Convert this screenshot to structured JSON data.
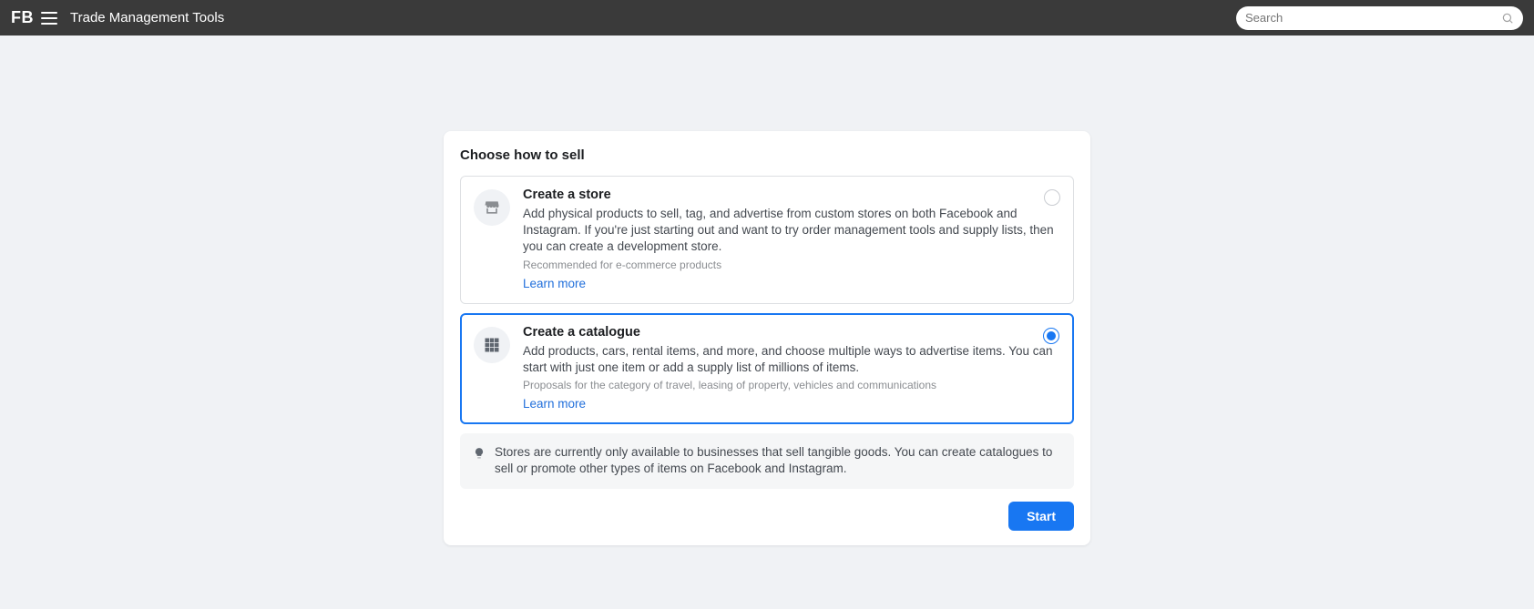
{
  "header": {
    "logo": "FB",
    "app_title": "Trade Management Tools",
    "search_placeholder": "Search"
  },
  "panel": {
    "title": "Choose how to sell",
    "options": [
      {
        "title": "Create a store",
        "desc": "Add physical products to sell, tag, and advertise from custom stores on both Facebook and Instagram. If you're just starting out and want to try order management tools and supply lists, then you can create a development store.",
        "hint": "Recommended for e-commerce products",
        "learn_more": "Learn more"
      },
      {
        "title": "Create a catalogue",
        "desc": "Add products, cars, rental items, and more, and choose multiple ways to advertise items. You can start with just one item or add a supply list of millions of items.",
        "hint": "Proposals for the category of travel, leasing of property, vehicles and communications",
        "learn_more": "Learn more"
      }
    ],
    "note": "Stores are currently only available to businesses that sell tangible goods. You can create catalogues to sell or promote other types of items on Facebook and Instagram.",
    "start_button": "Start"
  }
}
